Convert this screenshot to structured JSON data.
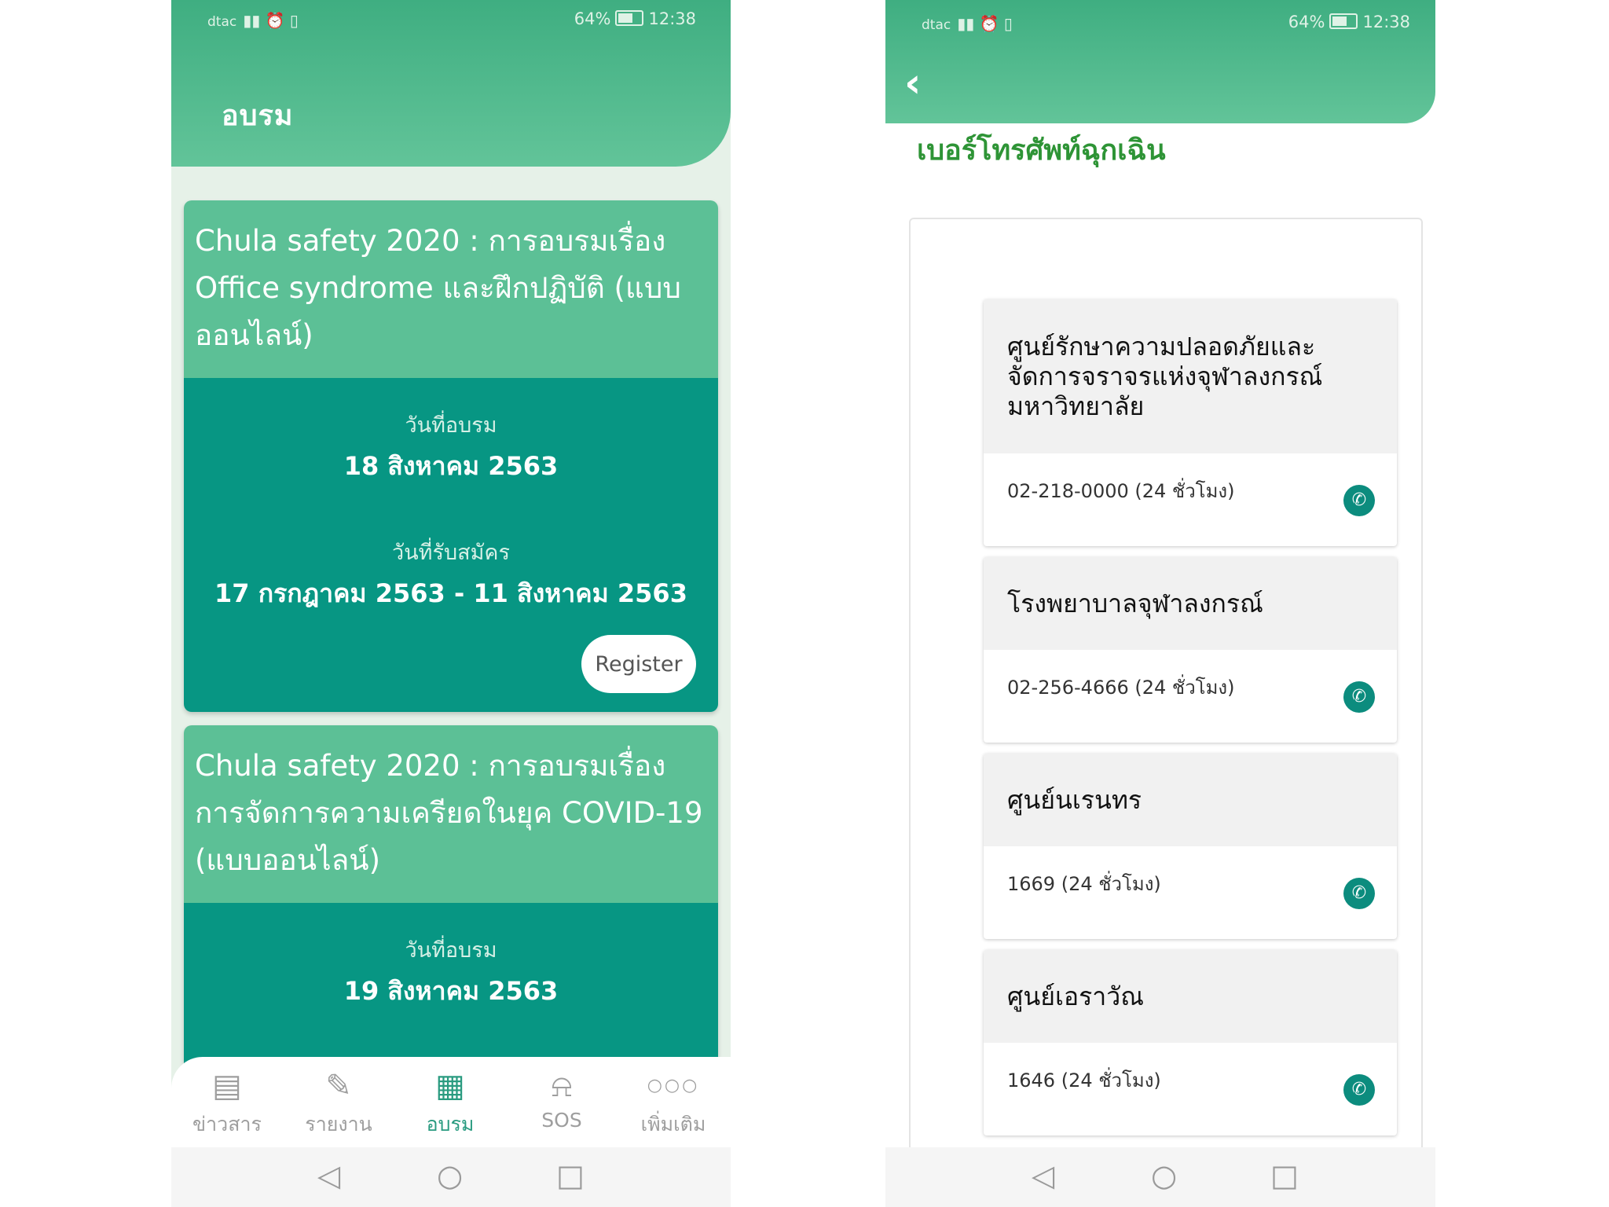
{
  "status_bar": {
    "carrier": "dtac",
    "battery": "64%",
    "time": "12:38"
  },
  "training": {
    "title": "อบรม",
    "courses": [
      {
        "title": "Chula safety 2020 : การอบรมเรื่อง Office syndrome และฝึกปฏิบัติ (แบบออนไลน์)",
        "date_label": "วันที่อบรม",
        "date": "18 สิงหาคม 2563",
        "reg_label": "วันที่รับสมัคร",
        "reg_range": "17 กรกฎาคม 2563  - 11 สิงหาคม 2563",
        "register_label": "Register"
      },
      {
        "title": "Chula safety 2020 : การอบรมเรื่อง การจัดการความเครียดในยุค COVID-19 (แบบออนไลน์)",
        "date_label": "วันที่อบรม",
        "date": "19 สิงหาคม 2563"
      }
    ]
  },
  "bottom_nav": [
    {
      "label": "ข่าวสาร",
      "icon": "news-icon"
    },
    {
      "label": "รายงาน",
      "icon": "report-icon"
    },
    {
      "label": "อบรม",
      "icon": "training-icon",
      "active": true
    },
    {
      "label": "SOS",
      "icon": "alarm-bell-icon"
    },
    {
      "label": "เพิ่มเติม",
      "icon": "more-icon"
    }
  ],
  "system_nav": {
    "back": "◁",
    "home": "○",
    "recent": "□"
  },
  "emergency": {
    "title": "เบอร์โทรศัพท์ฉุกเฉิน",
    "contacts": [
      {
        "name": "ศูนย์รักษาความปลอดภัยและจัดการจราจรแห่งจุฬาลงกรณ์มหาวิทยาลัย",
        "phone": "02-218-0000 (24 ชั่วโมง)"
      },
      {
        "name": "โรงพยาบาลจุฬาลงกรณ์",
        "phone": "02-256-4666 (24 ชั่วโมง)"
      },
      {
        "name": "ศูนย์นเรนทร",
        "phone": "1669 (24 ชั่วโมง)"
      },
      {
        "name": "ศูนย์เอราวัณ",
        "phone": "1646 (24 ชั่วโมง)"
      }
    ]
  }
}
